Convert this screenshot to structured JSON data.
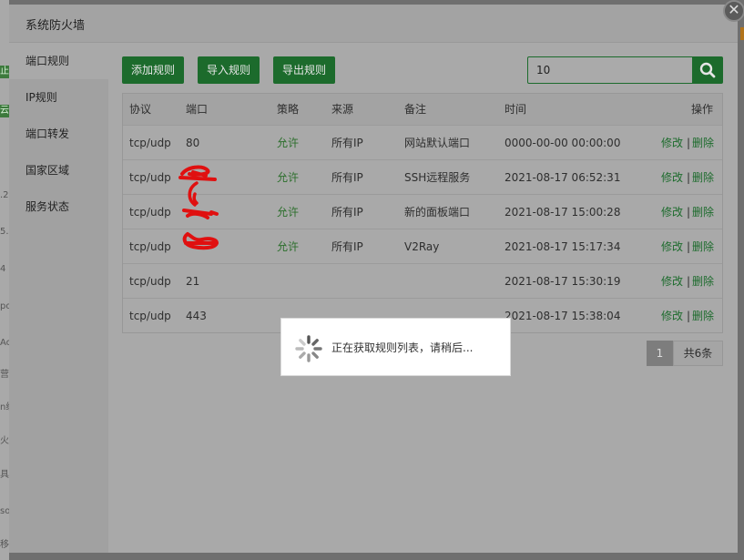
{
  "background": {
    "fragments": [
      ".2",
      "5.",
      "4",
      "po",
      "Ac",
      "营",
      "n级",
      "火墙",
      "具",
      "so",
      "移"
    ],
    "accent_left": "止",
    "accent_left2": "云i"
  },
  "modal": {
    "title": "系统防火墙",
    "close_icon": "close-icon"
  },
  "sidebar": {
    "items": [
      {
        "label": "端口规则"
      },
      {
        "label": "IP规则"
      },
      {
        "label": "端口转发"
      },
      {
        "label": "国家区域"
      },
      {
        "label": "服务状态"
      }
    ]
  },
  "toolbar": {
    "add_label": "添加规则",
    "import_label": "导入规则",
    "export_label": "导出规则",
    "search_value": "10"
  },
  "table": {
    "headers": [
      "协议",
      "端口",
      "策略",
      "来源",
      "备注",
      "时间",
      "操作"
    ],
    "rows": [
      {
        "protocol": "tcp/udp",
        "port": "80",
        "policy": "允许",
        "source": "所有IP",
        "note": "网站默认端口",
        "time": "0000-00-00 00:00:00",
        "edit": "修改",
        "delete": "删除"
      },
      {
        "protocol": "tcp/udp",
        "port": "",
        "policy": "允许",
        "source": "所有IP",
        "note": "SSH远程服务",
        "time": "2021-08-17 06:52:31",
        "edit": "修改",
        "delete": "删除"
      },
      {
        "protocol": "tcp/udp",
        "port": "",
        "policy": "允许",
        "source": "所有IP",
        "note": "新的面板端口",
        "time": "2021-08-17 15:00:28",
        "edit": "修改",
        "delete": "删除"
      },
      {
        "protocol": "tcp/udp",
        "port": "",
        "policy": "允许",
        "source": "所有IP",
        "note": "V2Ray",
        "time": "2021-08-17 15:17:34",
        "edit": "修改",
        "delete": "删除"
      },
      {
        "protocol": "tcp/udp",
        "port": "21",
        "policy": "",
        "source": "",
        "note": "",
        "time": "2021-08-17 15:30:19",
        "edit": "修改",
        "delete": "删除"
      },
      {
        "protocol": "tcp/udp",
        "port": "443",
        "policy": "",
        "source": "",
        "note": "",
        "time": "2021-08-17 15:38:04",
        "edit": "修改",
        "delete": "删除"
      }
    ]
  },
  "loading": {
    "message": "正在获取规则列表，请稍后..."
  },
  "pager": {
    "current": "1",
    "total": "共6条"
  },
  "colors": {
    "brand_green": "#1c6b2c",
    "allow_green": "#2c6f2c"
  }
}
